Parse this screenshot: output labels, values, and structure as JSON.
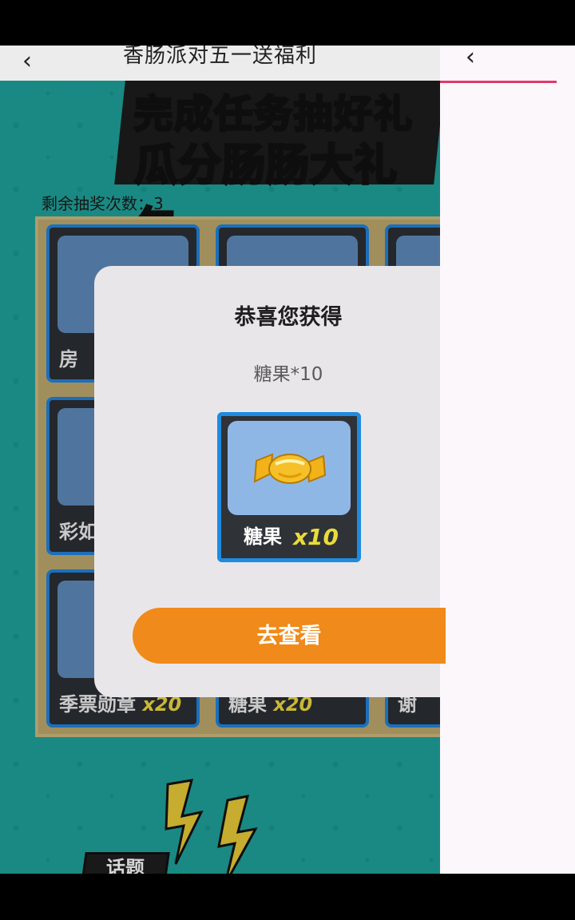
{
  "nav": {
    "back_icon": "‹",
    "title": "香肠派对五一送福利"
  },
  "banner": {
    "line1": "完成任务抽好礼",
    "line2_prefix": "瓜分肠肠",
    "line2_highlight": "大礼包"
  },
  "remaining_draws": "剩余抽奖次数：3",
  "grid": {
    "cells": [
      {
        "label": "房",
        "qty": ""
      },
      {
        "label": "",
        "qty": ""
      },
      {
        "label": "",
        "qty": ""
      },
      {
        "label": "彩如",
        "qty": ""
      },
      {
        "label": "",
        "qty": ""
      },
      {
        "label": "",
        "qty": ""
      },
      {
        "label": "季票勋章",
        "qty": "x20"
      },
      {
        "label": "糖果",
        "qty": "x20"
      },
      {
        "label": "谢",
        "qty": ""
      }
    ]
  },
  "topic_chip": "话题",
  "right_pane": {
    "back_icon": "‹"
  },
  "modal": {
    "title": "恭喜您获得",
    "subtitle": "糖果*10",
    "prize_name": "糖果",
    "prize_qty": "x10",
    "button": "去查看"
  },
  "colors": {
    "page_bg": "#1e9d96",
    "modal_bg": "#e9e6ea",
    "button": "#f08a1a",
    "accent": "#e2386a",
    "card_border": "#1f8be0"
  }
}
